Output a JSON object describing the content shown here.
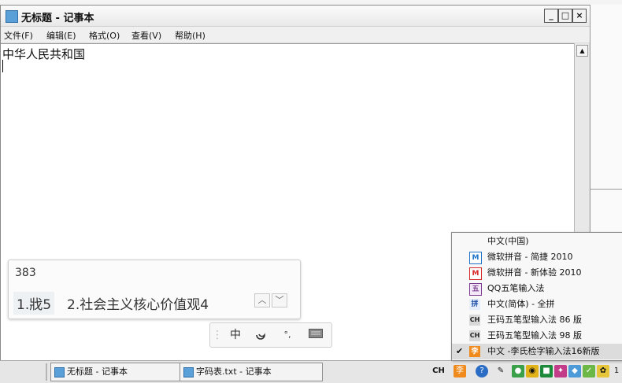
{
  "window": {
    "title": "无标题 - 记事本",
    "min_label": "_",
    "max_label": "□",
    "close_label": "×"
  },
  "menu": [
    {
      "label": "文件(F)"
    },
    {
      "label": "编辑(E)"
    },
    {
      "label": "格式(O)"
    },
    {
      "label": "查看(V)"
    },
    {
      "label": "帮助(H)"
    }
  ],
  "editor": {
    "text": "中华人民共和国"
  },
  "ime_candidate": {
    "code": "383",
    "candidates": [
      {
        "label": "1.戕5"
      },
      {
        "label": "2.社会主义核心价值观4"
      }
    ],
    "prev_icon": "chevron-up",
    "next_icon": "chevron-down"
  },
  "ime_toolbar": {
    "mode_label": "中",
    "moon_icon": "half-width-moon",
    "punct_label": "°,",
    "keyboard_icon": "keyboard"
  },
  "taskbar": {
    "tasks": [
      {
        "label": "无标题 - 记事本"
      },
      {
        "label": "字码表.txt - 记事本"
      }
    ],
    "tray_lang": "CH",
    "clock_partial": "1"
  },
  "ime_menu": {
    "items": [
      {
        "label": "中文(中国)",
        "icon": "",
        "checked": false
      },
      {
        "label": "微软拼音 - 简捷 2010",
        "icon": "M",
        "checked": false
      },
      {
        "label": "微软拼音 - 新体验 2010",
        "icon": "M",
        "checked": false
      },
      {
        "label": "QQ五笔输入法",
        "icon": "五",
        "checked": false
      },
      {
        "label": "中文(简体) - 全拼",
        "icon": "拼",
        "checked": false
      },
      {
        "label": "王码五笔型输入法 86 版",
        "icon": "CH",
        "checked": false
      },
      {
        "label": "王码五笔型输入法 98 版",
        "icon": "CH",
        "checked": false
      },
      {
        "label": "中文 -李氏检字输入法16新版",
        "icon": "李",
        "checked": true
      }
    ],
    "check_mark": "✔"
  },
  "colors": {
    "accent": "#5aa0d8",
    "ms_pinyin_icon": "#1e73c8",
    "ms_pinyin_new_icon": "#d62828",
    "li_icon": "#f08a1c"
  }
}
